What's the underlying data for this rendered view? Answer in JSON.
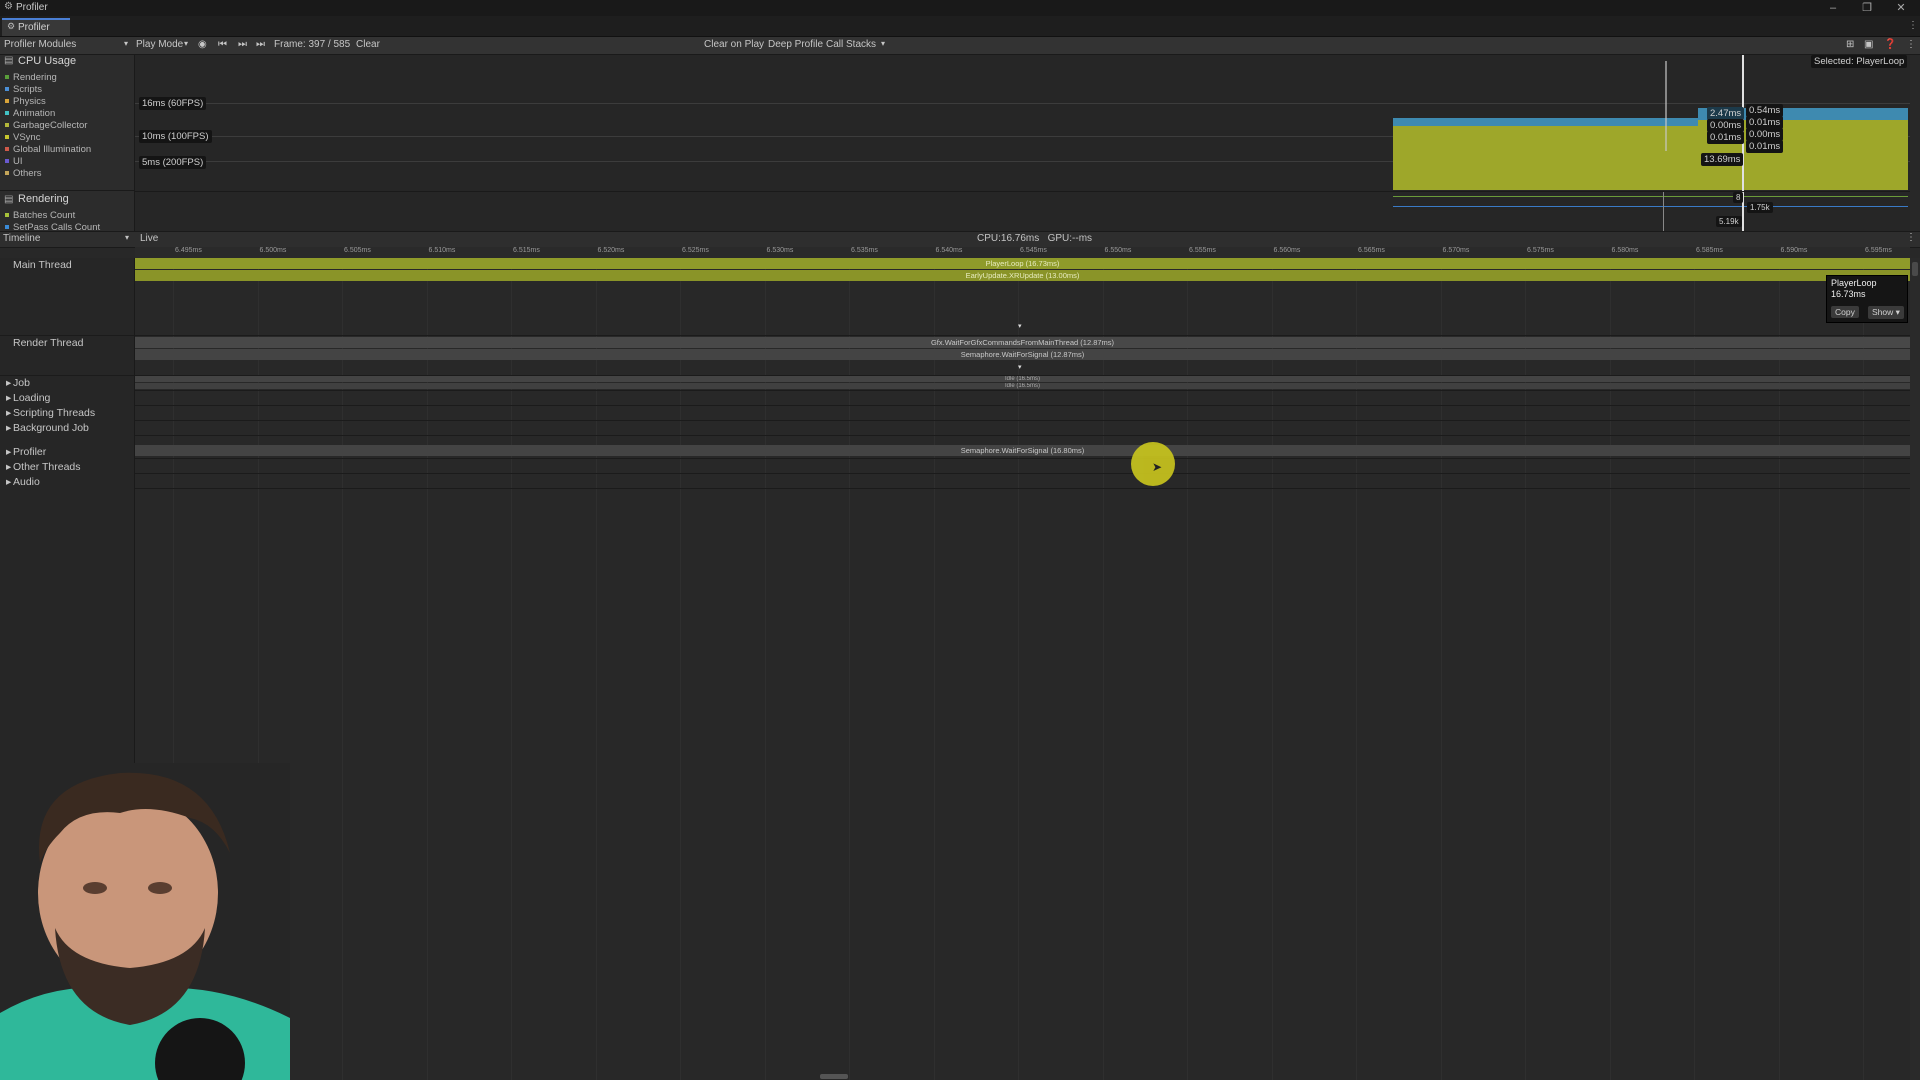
{
  "window": {
    "title": "Profiler",
    "tab_label": "Profiler"
  },
  "toolbar": {
    "modules_label": "Profiler Modules",
    "play_mode": "Play Mode",
    "frame": "Frame: 397 / 585",
    "clear": "Clear",
    "clear_on_play": "Clear on Play",
    "deep_profile": "Deep Profile",
    "call_stacks": "Call Stacks"
  },
  "modules": {
    "cpu": {
      "title": "CPU Usage",
      "items": [
        {
          "label": "Rendering",
          "color": "#5a9e3a"
        },
        {
          "label": "Scripts",
          "color": "#4b8fd6"
        },
        {
          "label": "Physics",
          "color": "#d9a43a"
        },
        {
          "label": "Animation",
          "color": "#42c2c4"
        },
        {
          "label": "GarbageCollector",
          "color": "#b3b73a"
        },
        {
          "label": "VSync",
          "color": "#c6c62e"
        },
        {
          "label": "Global Illumination",
          "color": "#d05a4a"
        },
        {
          "label": "UI",
          "color": "#6a5ad0"
        },
        {
          "label": "Others",
          "color": "#c4a55a"
        }
      ]
    },
    "rendering": {
      "title": "Rendering",
      "items": [
        {
          "label": "Batches Count",
          "color": "#a7c23a"
        },
        {
          "label": "SetPass Calls Count",
          "color": "#3a8ad6"
        }
      ]
    }
  },
  "graph": {
    "fps_labels": [
      "16ms (60FPS)",
      "10ms (100FPS)",
      "5ms (200FPS)"
    ],
    "selected": "Selected: PlayerLoop",
    "left_values": [
      "2.47ms",
      "0.00ms",
      "0.01ms",
      "13.69ms"
    ],
    "right_values": [
      "0.54ms",
      "0.01ms",
      "0.00ms",
      "0.01ms"
    ],
    "render_values": [
      "8",
      "1.75k",
      "5.19k"
    ]
  },
  "timeline": {
    "mode": "Timeline",
    "live": "Live",
    "cpu_gpu": "CPU:16.76ms   GPU:--ms",
    "ticks": [
      "6.495ms",
      "6.500ms",
      "6.505ms",
      "6.510ms",
      "6.515ms",
      "6.520ms",
      "6.525ms",
      "6.530ms",
      "6.535ms",
      "6.540ms",
      "6.545ms",
      "6.550ms",
      "6.555ms",
      "6.560ms",
      "6.565ms",
      "6.570ms",
      "6.575ms",
      "6.580ms",
      "6.585ms",
      "6.590ms",
      "6.595ms"
    ],
    "threads": {
      "main": "Main Thread",
      "render": "Render Thread",
      "job": "Job",
      "loading": "Loading",
      "scripting": "Scripting Threads",
      "background": "Background Job",
      "profiler": "Profiler",
      "other": "Other Threads",
      "audio": "Audio"
    },
    "bars": {
      "playerloop": "PlayerLoop (16.73ms)",
      "earlyupdate": "EarlyUpdate.XRUpdate (13.00ms)",
      "gfx_wait": "Gfx.WaitForGfxCommandsFromMainThread (12.87ms)",
      "semaphore_render": "Semaphore.WaitForSignal (12.87ms)",
      "job_idle1": "Idle (16.5ms)",
      "job_idle2": "Idle (16.5ms)",
      "semaphore_profiler": "Semaphore.WaitForSignal (16.80ms)"
    }
  },
  "tooltip": {
    "name": "PlayerLoop",
    "time": "16.73ms",
    "copy": "Copy",
    "show": "Show ▾"
  },
  "colors": {
    "accent": "#4a7fd4",
    "cpu_fill": "#9ea72a",
    "main_bar": "#8f9b2a",
    "cursor": "#c8c41e"
  }
}
